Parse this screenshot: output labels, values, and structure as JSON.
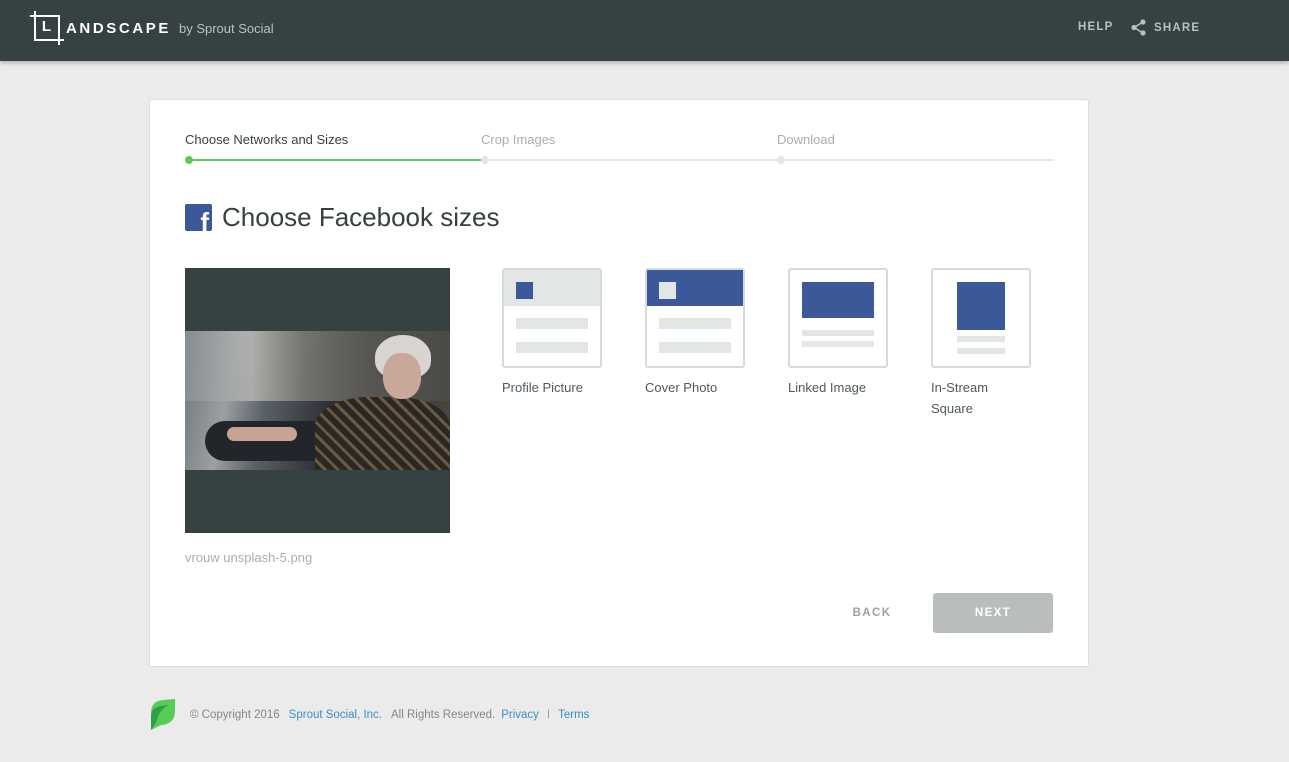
{
  "header": {
    "logo_letter": "L",
    "logo_word": "ANDSCAPE",
    "logo_by": "by Sprout Social",
    "help_label": "HELP",
    "share_label": "SHARE"
  },
  "steps": [
    {
      "label": "Choose Networks and Sizes",
      "state": "active"
    },
    {
      "label": "Crop Images",
      "state": "pending"
    },
    {
      "label": "Download",
      "state": "pending"
    }
  ],
  "main": {
    "network_icon": "facebook-icon",
    "title": "Choose Facebook sizes",
    "filename": "vrouw unsplash-5.png",
    "sizes": [
      {
        "label": "Profile Picture"
      },
      {
        "label": "Cover Photo"
      },
      {
        "label": "Linked Image"
      },
      {
        "label": "In-Stream Square"
      }
    ],
    "back_label": "BACK",
    "next_label": "NEXT"
  },
  "footer": {
    "copyright": "© Copyright 2016",
    "company_link": "Sprout Social, Inc.",
    "rights": "All Rights Reserved.",
    "privacy_link": "Privacy",
    "separator": "I",
    "terms_link": "Terms"
  },
  "colors": {
    "header_bg": "#364141",
    "accent_green": "#59cb59",
    "facebook_blue": "#3b5998",
    "link_blue": "#3a8fbf"
  }
}
